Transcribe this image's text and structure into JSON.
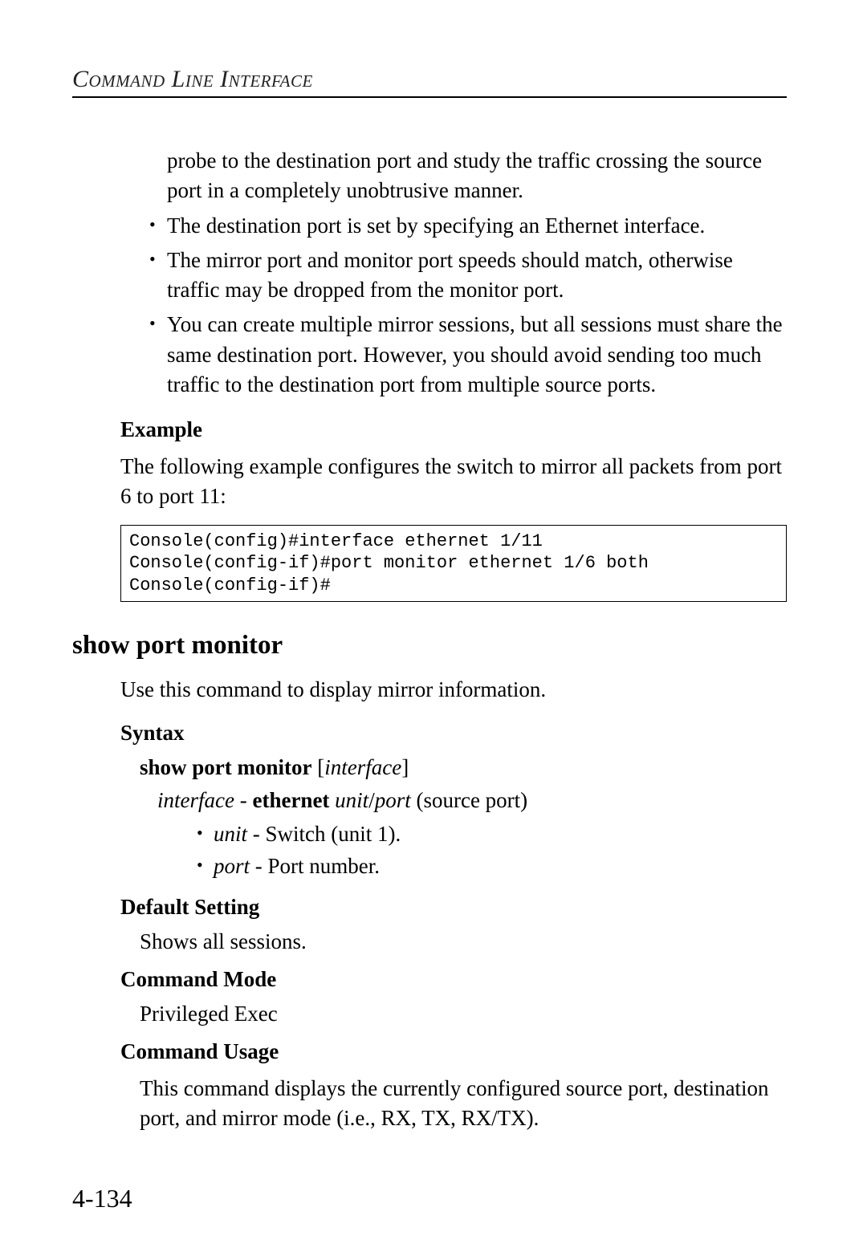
{
  "header": {
    "running": "Command Line Interface"
  },
  "top": {
    "cont_para": "probe to the destination port and study the traffic crossing the source port in a completely unobtrusive manner.",
    "bullets": [
      "The destination port is set by specifying an Ethernet interface.",
      "The mirror port and monitor port speeds should match, otherwise traffic may be dropped from the monitor port.",
      "You can create multiple mirror sessions, but all sessions must share the same destination port. However, you should avoid sending too much traffic to the destination port from multiple source ports."
    ],
    "example_head": "Example",
    "example_intro": "The following example configures the switch to mirror all packets from port 6 to port 11:",
    "code": "Console(config)#interface ethernet 1/11\nConsole(config-if)#port monitor ethernet 1/6 both\nConsole(config-if)#"
  },
  "section": {
    "title": "show port monitor",
    "desc": "Use this command to display mirror information.",
    "syntax_head": "Syntax",
    "syntax_cmd_bold": "show port monitor",
    "syntax_cmd_arg": "interface",
    "interface_line_pre": "interface",
    "interface_line_dash": " - ",
    "interface_line_bold": "ethernet",
    "interface_line_unit": "unit",
    "interface_line_slash": "/",
    "interface_line_port": "port",
    "interface_line_paren": " (source port)",
    "inner_bullets": {
      "unit_ital": "unit",
      "unit_rest": " - Switch (unit 1).",
      "port_ital": "port",
      "port_rest": " - Port number."
    },
    "default_head": "Default Setting",
    "default_text": "Shows all sessions.",
    "mode_head": "Command Mode",
    "mode_text": "Privileged Exec",
    "usage_head": "Command Usage",
    "usage_text": "This command displays the currently configured source port, destination port, and mirror mode (i.e., RX, TX, RX/TX)."
  },
  "footer": {
    "page": "4-134"
  }
}
